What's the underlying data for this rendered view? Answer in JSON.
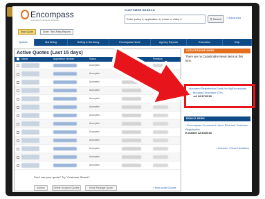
{
  "header": {
    "logo_text": "Encompass",
    "logo_sub": "Automated Insurance Solutions"
  },
  "search": {
    "label": "CUSTOMER SEARCH",
    "placeholder": "Enter policy #, application #, name or claim #",
    "button": "Search",
    "advanced": "+ Advanced"
  },
  "actions": {
    "start_quote": "Start Quote",
    "third_party": "Order Third-Party Reports"
  },
  "nav": {
    "items": [
      {
        "label": "Quotes",
        "active": true
      },
      {
        "label": "Marketing",
        "active": false
      },
      {
        "label": "Selling & Servicing",
        "active": false
      },
      {
        "label": "Encompass News",
        "active": false
      },
      {
        "label": "Agency Reports",
        "active": false
      },
      {
        "label": "Education",
        "active": false
      },
      {
        "label": "Help",
        "active": false
      }
    ]
  },
  "quotes": {
    "title": "Active Quotes (Last 15 days)",
    "columns": [
      "Name",
      "Application Number",
      "Status",
      "Customer",
      "Premium"
    ],
    "rows": [
      {
        "status": "Accepted"
      },
      {
        "status": "Accepted"
      },
      {
        "status": "Accepted"
      },
      {
        "status": "Accepted"
      },
      {
        "status": "Accepted"
      },
      {
        "status": "Accepted"
      },
      {
        "status": "Accepted"
      },
      {
        "status": "Accepted"
      },
      {
        "status": "Accepted"
      },
      {
        "status": "Accepted"
      },
      {
        "status": "Accepted"
      },
      {
        "status": "Accepted"
      },
      {
        "status": "Accepted"
      }
    ],
    "no_quote_text": "Don't see your quote? Try \"Customer Search\"",
    "buttons": [
      "Actions",
      "Delete Grouped Quotes",
      "Email Package Quote"
    ],
    "more_link": "+ More Active Quotes"
  },
  "catastrophe": {
    "header": "CATASTROPHE NEWS",
    "text": "There are no Catastrophe News items at this time."
  },
  "news_highlight": {
    "title": "• Automated Registration Email for MyEncompass - Live Monday December 17th",
    "date": "E-mailed 12/17/2018"
  },
  "emails": {
    "header": "EMAILS NEWS",
    "title": "• Encompass Connected Home Pilot and Customer Registration",
    "date": "E-mailed 12/10/2018",
    "links": "+ Archives   + More Headlines"
  },
  "colors": {
    "nav_blue": "#0e4a86",
    "orange": "#e36e1d",
    "highlight_red": "#e8141b"
  }
}
